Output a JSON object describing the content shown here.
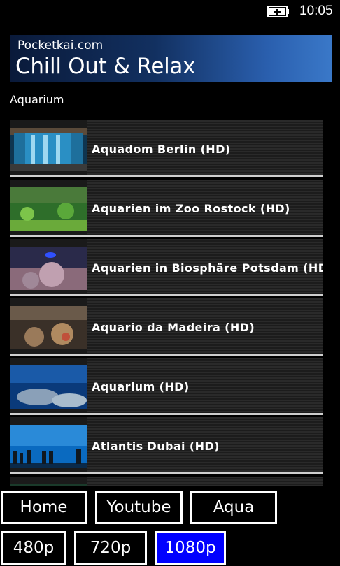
{
  "status_bar": {
    "time": "10:05",
    "battery_icon": "battery-charging-icon"
  },
  "header": {
    "site": "Pocketkai.com",
    "title": "Chill Out & Relax"
  },
  "section_label": "Aquarium",
  "videos": [
    {
      "title": "Aquadom Berlin (HD)"
    },
    {
      "title": "Aquarien im Zoo Rostock (HD)"
    },
    {
      "title": "Aquarien in Biosphäre Potsdam (HD)"
    },
    {
      "title": "Aquario da Madeira (HD)"
    },
    {
      "title": "Aquarium (HD)"
    },
    {
      "title": "Atlantis Dubai (HD)"
    }
  ],
  "nav_buttons": {
    "home": "Home",
    "youtube": "Youtube",
    "aqua": "Aqua"
  },
  "quality_buttons": {
    "q480": "480p",
    "q720": "720p",
    "q1080": "1080p",
    "selected": "1080p"
  },
  "colors": {
    "selected_button": "#0000ff",
    "header_gradient_end": "#3a78c8"
  }
}
